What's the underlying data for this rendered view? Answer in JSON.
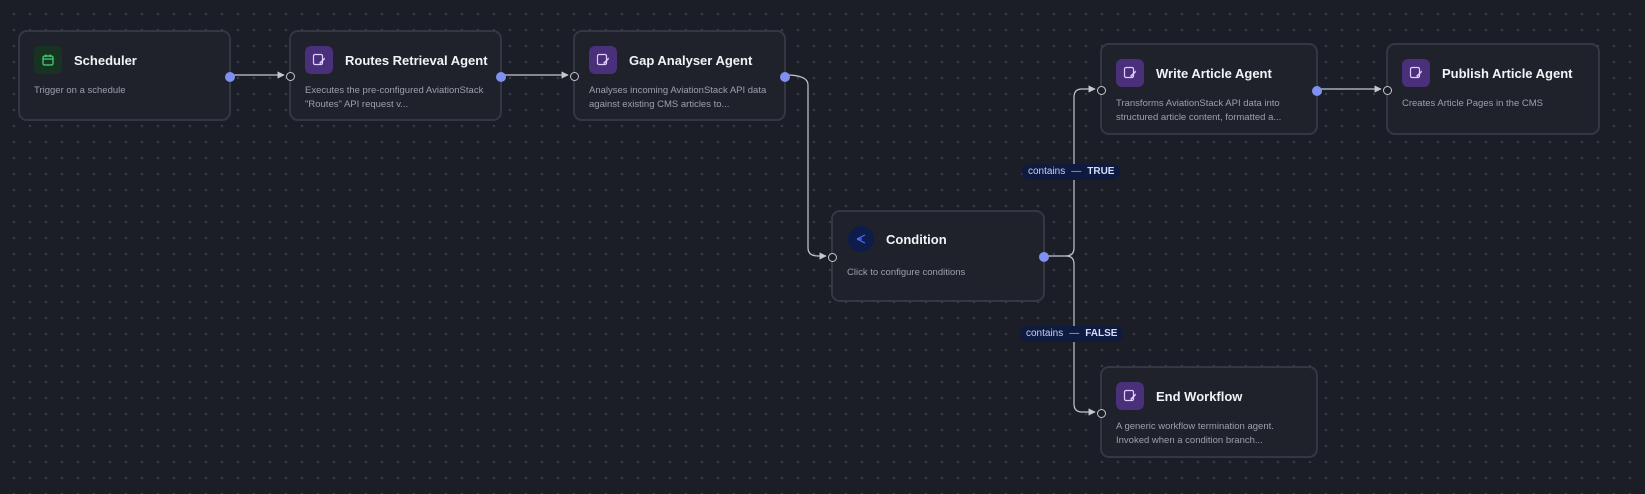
{
  "nodes": {
    "scheduler": {
      "title": "Scheduler",
      "desc": "Trigger on a schedule"
    },
    "routes": {
      "title": "Routes Retrieval Agent",
      "desc": "Executes the pre-configured AviationStack \"Routes\" API request v..."
    },
    "gap": {
      "title": "Gap Analyser Agent",
      "desc": "Analyses incoming AviationStack API data against existing CMS articles to..."
    },
    "condition": {
      "title": "Condition",
      "desc": "Click to configure conditions"
    },
    "write": {
      "title": "Write Article Agent",
      "desc": "Transforms AviationStack API data into structured article content, formatted a..."
    },
    "publish": {
      "title": "Publish Article Agent",
      "desc": "Creates Article Pages in the CMS"
    },
    "end": {
      "title": "End Workflow",
      "desc": "A generic workflow termination agent. Invoked when a condition branch..."
    }
  },
  "edge_labels": {
    "true_branch": {
      "op": "contains",
      "sep": "—",
      "value": "TRUE"
    },
    "false_branch": {
      "op": "contains",
      "sep": "—",
      "value": "FALSE"
    }
  },
  "colors": {
    "canvas": "#1b1e26",
    "node_bg": "#1f222a",
    "node_border": "#343843",
    "handle_out": "#7f90f0",
    "agent_icon_bg": "#4a2f7a",
    "label_bg": "#0f1a3f"
  },
  "icons": {
    "scheduler": "calendar-icon",
    "agent": "agent-edit-icon",
    "condition": "branch-icon"
  }
}
